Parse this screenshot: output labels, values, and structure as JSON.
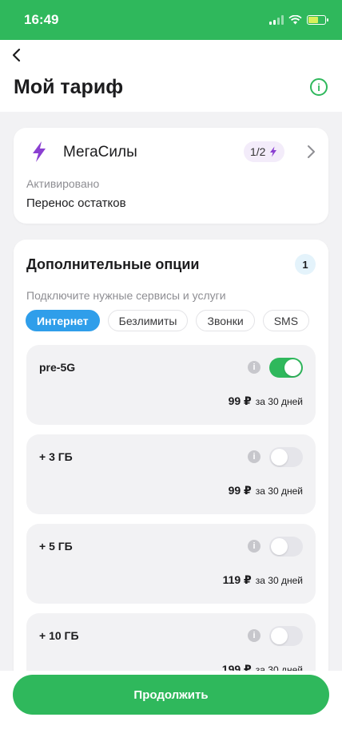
{
  "status_bar": {
    "time": "16:49"
  },
  "header": {
    "title": "Мой тариф",
    "info_icon": "i"
  },
  "tariff": {
    "name": "МегаСилы",
    "badge": "1/2",
    "status": "Активировано",
    "feature": "Перенос остатков"
  },
  "options": {
    "title": "Дополнительные опции",
    "count": "1",
    "subtitle": "Подключите нужные сервисы и услуги",
    "chips": [
      {
        "label": "Интернет",
        "active": true
      },
      {
        "label": "Безлимиты",
        "active": false
      },
      {
        "label": "Звонки",
        "active": false
      },
      {
        "label": "SMS",
        "active": false
      }
    ],
    "items": [
      {
        "name": "pre-5G",
        "price": "99 ₽",
        "period": "за 30 дней",
        "enabled": true
      },
      {
        "name": "+ 3 ГБ",
        "price": "99 ₽",
        "period": "за 30 дней",
        "enabled": false
      },
      {
        "name": "+ 5 ГБ",
        "price": "119 ₽",
        "period": "за 30 дней",
        "enabled": false
      },
      {
        "name": "+ 10 ГБ",
        "price": "199 ₽",
        "period": "за 30 дней",
        "enabled": false
      }
    ]
  },
  "footer": {
    "continue_label": "Продолжить"
  },
  "colors": {
    "accent": "#2fb85c",
    "chip_active": "#2f9eea",
    "bolt": "#8a3fd1"
  }
}
